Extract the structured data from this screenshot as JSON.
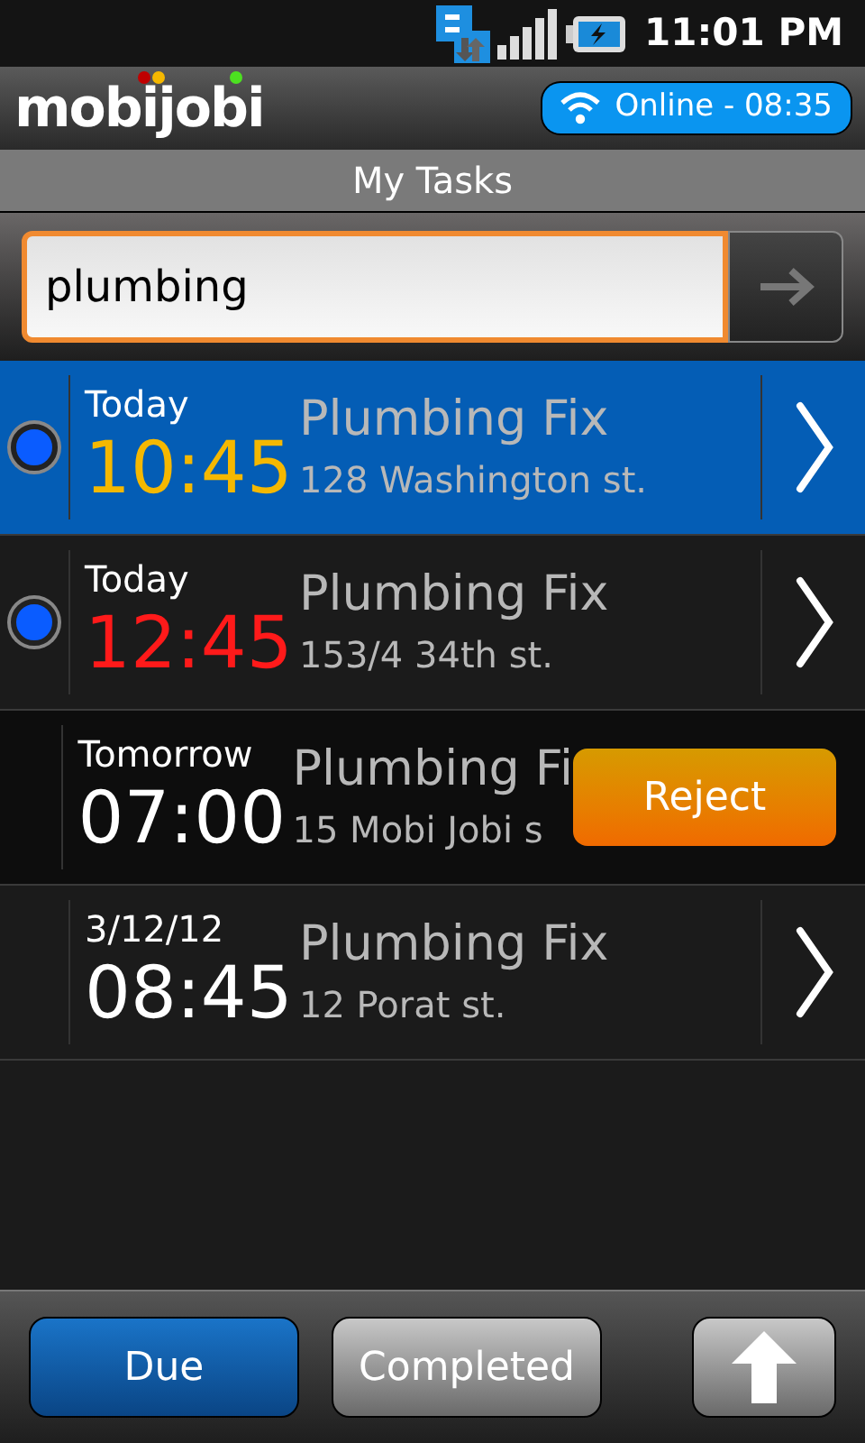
{
  "status_bar": {
    "time": "11:01 PM"
  },
  "header": {
    "logo": "mobijobi",
    "connection": "Online - 08:35"
  },
  "title": "My Tasks",
  "search": {
    "value": "plumbing"
  },
  "tasks": [
    {
      "kind": "task",
      "selected": true,
      "flagged": true,
      "day": "Today",
      "time": "10:45",
      "color": "#f5b800",
      "title": "Plumbing Fix",
      "address": "128 Washington st."
    },
    {
      "kind": "task",
      "selected": false,
      "flagged": true,
      "day": "Today",
      "time": "12:45",
      "color": "#ff1a1a",
      "title": "Plumbing Fix",
      "address": "153/4 34th st."
    },
    {
      "kind": "swiped",
      "selected": false,
      "flagged": false,
      "day": "Tomorrow",
      "time": "07:00",
      "color": "#ffffff",
      "title": "Plumbing Fi",
      "address": "15 Mobi Jobi s",
      "action": "Reject"
    },
    {
      "kind": "task",
      "selected": false,
      "flagged": false,
      "day": "3/12/12",
      "time": "08:45",
      "color": "#ffffff",
      "title": "Plumbing Fix",
      "address": "12 Porat st."
    }
  ],
  "tabs": [
    {
      "label": "Due",
      "selected": true
    },
    {
      "label": "Completed",
      "selected": false
    }
  ]
}
